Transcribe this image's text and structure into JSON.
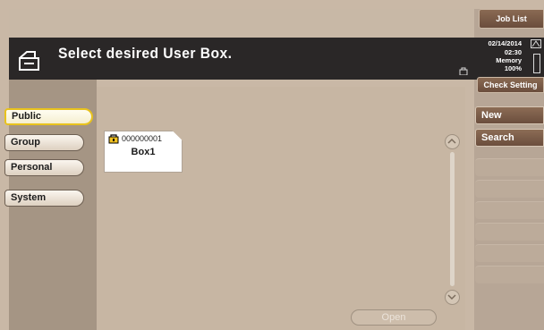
{
  "header": {
    "title": "Select desired User Box."
  },
  "right_panel": {
    "job_list": "Job List",
    "date": "02/14/2014",
    "time": "02:30",
    "memory_label": "Memory",
    "memory_value": "100%",
    "check_setting": "Check Setting",
    "actions": [
      "New",
      "Search"
    ]
  },
  "tabs": [
    {
      "label": "Public",
      "selected": true
    },
    {
      "label": "Group",
      "selected": false
    },
    {
      "label": "Personal",
      "selected": false
    },
    {
      "label": "System",
      "selected": false
    }
  ],
  "boxes": [
    {
      "number": "000000001",
      "name": "Box1"
    }
  ],
  "footer": {
    "open_label": "Open"
  },
  "colors": {
    "header_bg": "#2a2727",
    "accent_selected": "#e8c21d",
    "button_brown": "#6a4d3c"
  }
}
